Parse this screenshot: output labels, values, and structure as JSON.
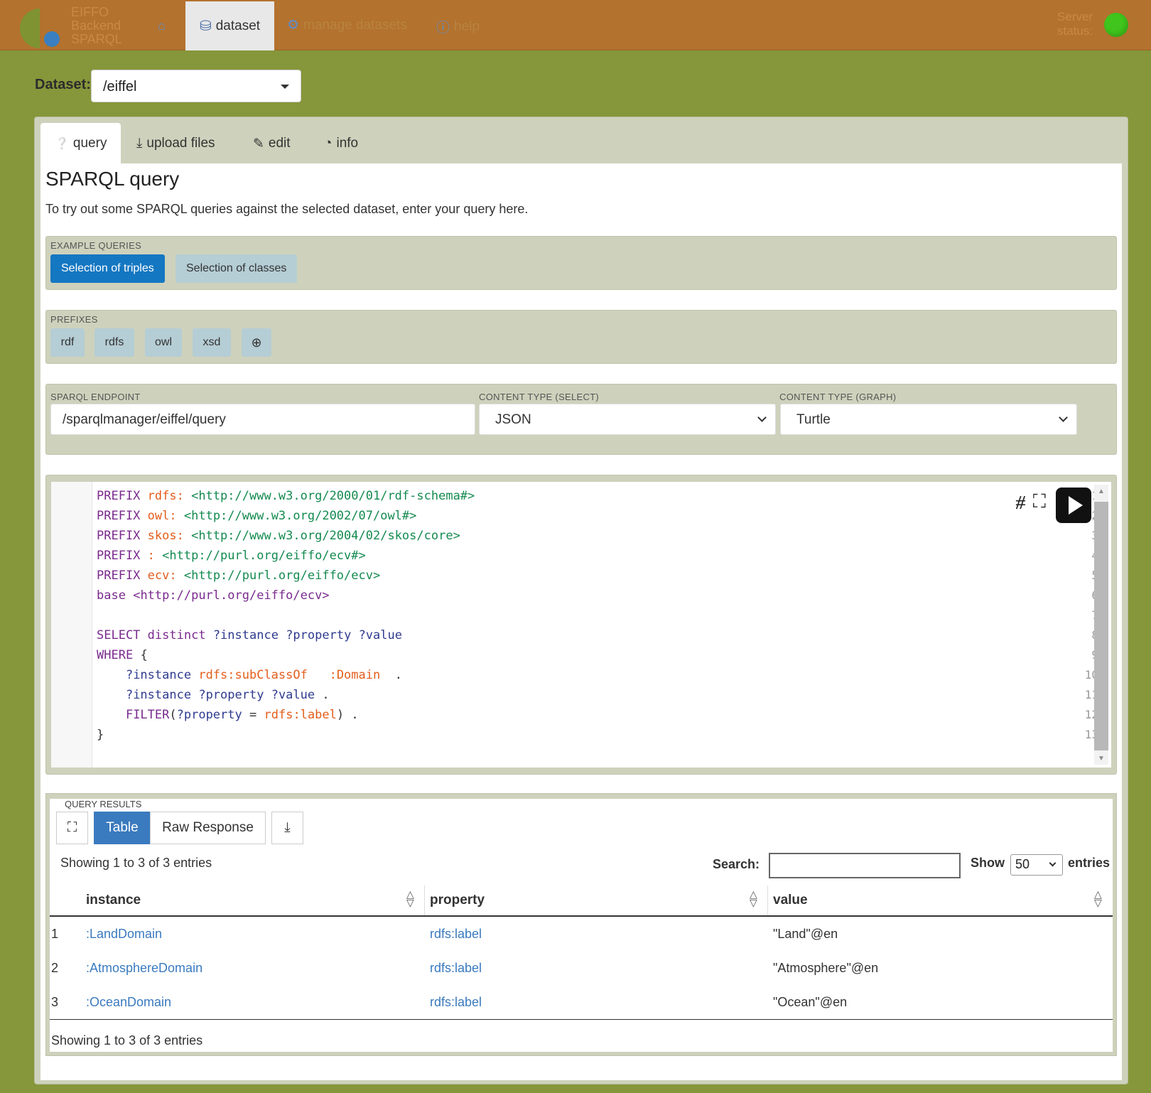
{
  "nav": {
    "logo_lines": [
      "EIFFO",
      "Backend",
      "SPARQL"
    ],
    "items": [
      {
        "label": "dataset",
        "icon": "database-icon",
        "active": true
      },
      {
        "label": "manage datasets",
        "icon": "gears-icon"
      },
      {
        "label": "help",
        "icon": "info-circle-icon"
      }
    ],
    "status_label": [
      "Server",
      "status:"
    ],
    "status_color": "#3fc51c"
  },
  "dataset": {
    "label": "Dataset:",
    "value": "/eiffel"
  },
  "tabs": [
    {
      "label": "query",
      "icon": "question-circle-icon"
    },
    {
      "label": "upload files",
      "icon": "upload-icon"
    },
    {
      "label": "edit",
      "icon": "edit-icon"
    },
    {
      "label": "info",
      "icon": "dashboard-icon"
    }
  ],
  "query": {
    "title": "SPARQL query",
    "description": "To try out some SPARQL queries against the selected dataset, enter your query here."
  },
  "examples": {
    "label": "EXAMPLE QUERIES",
    "buttons": [
      "Selection of triples",
      "Selection of classes"
    ]
  },
  "prefixes": {
    "label": "PREFIXES",
    "buttons": [
      "rdf",
      "rdfs",
      "owl",
      "xsd"
    ]
  },
  "endpoint": {
    "label": "SPARQL ENDPOINT",
    "value": "/sparqlmanager/eiffel/query",
    "select_label": "CONTENT TYPE (SELECT)",
    "select_value": "JSON",
    "graph_label": "CONTENT TYPE (GRAPH)",
    "graph_value": "Turtle"
  },
  "editor": {
    "line_numbers": [
      "1",
      "2",
      "3",
      "4",
      "5",
      "6",
      "7",
      "8",
      "9",
      "10",
      "11",
      "12",
      "13"
    ],
    "tokens": {
      "prefix": "PREFIX",
      "base": "base",
      "select": "SELECT",
      "distinct": "distinct",
      "where": "WHERE",
      "filter": "FILTER",
      "rdfs": "rdfs:",
      "owl": "owl:",
      "skos": "skos:",
      "colon": ":",
      "ecv": "ecv:",
      "uri_rdfs": "<http://www.w3.org/2000/01/rdf-schema#>",
      "uri_owl": "<http://www.w3.org/2002/07/owl#>",
      "uri_skos": "<http://www.w3.org/2004/02/skos/core>",
      "uri_eiffo": "<http://purl.org/eiffo/ecv#>",
      "uri_ecv": "<http://purl.org/eiffo/ecv>",
      "uri_base": "<http://purl.org/eiffo/ecv>",
      "v_instance": "?instance",
      "v_property": "?property",
      "v_value": "?value",
      "subclassof": "rdfs:subClassOf",
      "domain": ":Domain",
      "label": "rdfs:label",
      "open_brace": "{",
      "close_brace": "}",
      "dot": ".",
      "eq": "=",
      "lparen": "(",
      "rparen": ")"
    }
  },
  "results": {
    "label": "QUERY RESULTS",
    "view_buttons": [
      "Table",
      "Raw Response"
    ],
    "info": "Showing 1 to 3 of 3 entries",
    "search_label": "Search:",
    "show_label": "Show",
    "page_size": "50",
    "entries_label": "entries",
    "columns": [
      "instance",
      "property",
      "value"
    ],
    "rows": [
      {
        "n": "1",
        "instance": ":LandDomain",
        "property": "rdfs:label",
        "value": "\"Land\"@en"
      },
      {
        "n": "2",
        "instance": ":AtmosphereDomain",
        "property": "rdfs:label",
        "value": "\"Atmosphere\"@en"
      },
      {
        "n": "3",
        "instance": ":OceanDomain",
        "property": "rdfs:label",
        "value": "\"Ocean\"@en"
      }
    ]
  }
}
